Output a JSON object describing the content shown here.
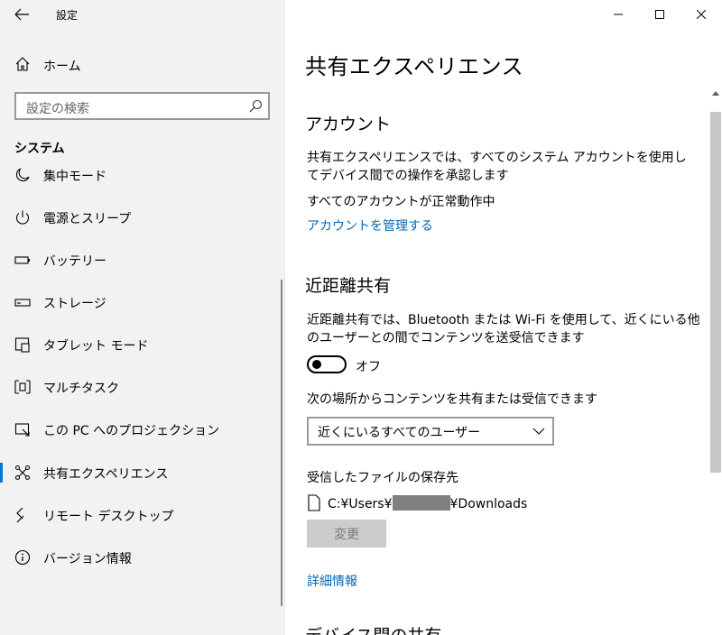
{
  "window": {
    "title": "設定",
    "controls": [
      "minimize",
      "maximize",
      "close"
    ]
  },
  "sidebar": {
    "home_label": "ホーム",
    "search_placeholder": "設定の検索",
    "section_title": "システム",
    "items": [
      {
        "label": "集中モード",
        "icon": "moon-icon"
      },
      {
        "label": "電源とスリープ",
        "icon": "power-icon"
      },
      {
        "label": "バッテリー",
        "icon": "battery-icon"
      },
      {
        "label": "ストレージ",
        "icon": "storage-icon"
      },
      {
        "label": "タブレット モード",
        "icon": "tablet-mode-icon"
      },
      {
        "label": "マルチタスク",
        "icon": "multitask-icon"
      },
      {
        "label": "この PC へのプロジェクション",
        "icon": "projection-icon"
      },
      {
        "label": "共有エクスペリエンス",
        "icon": "shared-experience-icon",
        "selected": true
      },
      {
        "label": "リモート デスクトップ",
        "icon": "remote-desktop-icon"
      },
      {
        "label": "バージョン情報",
        "icon": "info-icon"
      }
    ]
  },
  "main": {
    "page_title": "共有エクスペリエンス",
    "account": {
      "heading": "アカウント",
      "description": "共有エクスペリエンスでは、すべてのシステム アカウントを使用してデバイス間での操作を承認します",
      "status": "すべてのアカウントが正常動作中",
      "manage_link": "アカウントを管理する"
    },
    "nearby": {
      "heading": "近距離共有",
      "description": "近距離共有では、Bluetooth または Wi-Fi を使用して、近くにいる他のユーザーとの間でコンテンツを送受信できます",
      "toggle_state": "オフ",
      "toggle_on": false,
      "share_label": "次の場所からコンテンツを共有または受信できます",
      "share_selected": "近くにいるすべてのユーザー",
      "save_label": "受信したファイルの保存先",
      "path_prefix": "C:¥Users¥",
      "path_suffix": "¥Downloads",
      "change_button": "変更",
      "details_link": "詳細情報"
    },
    "next_heading": "デバイス間の共有"
  },
  "colors": {
    "accent": "#0078d7",
    "link": "#0067b8",
    "sidebar_bg": "#f2f2f2"
  }
}
